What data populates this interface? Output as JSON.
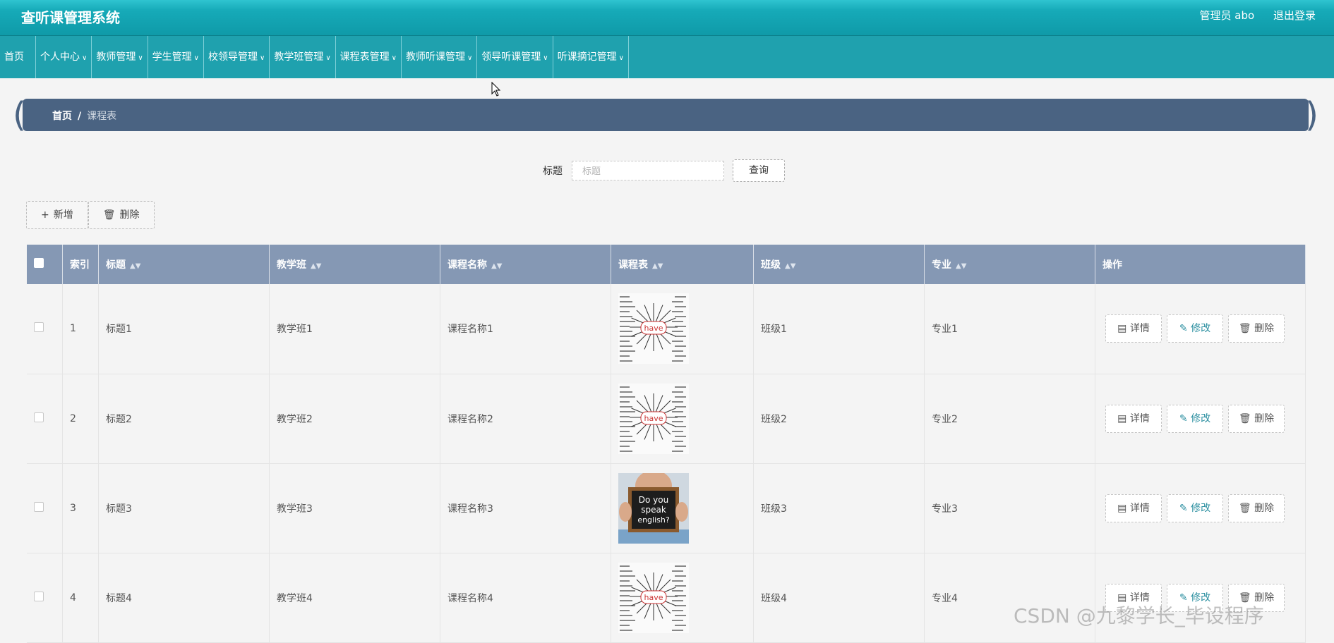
{
  "app": {
    "title": "查听课管理系统"
  },
  "user": {
    "admin_label": "管理员 abo",
    "logout": "退出登录"
  },
  "nav": [
    {
      "label": "首页",
      "dropdown": false
    },
    {
      "label": "个人中心",
      "dropdown": true
    },
    {
      "label": "教师管理",
      "dropdown": true
    },
    {
      "label": "学生管理",
      "dropdown": true
    },
    {
      "label": "校领导管理",
      "dropdown": true
    },
    {
      "label": "教学班管理",
      "dropdown": true
    },
    {
      "label": "课程表管理",
      "dropdown": true
    },
    {
      "label": "教师听课管理",
      "dropdown": true
    },
    {
      "label": "领导听课管理",
      "dropdown": true
    },
    {
      "label": "听课摘记管理",
      "dropdown": true
    }
  ],
  "breadcrumb": {
    "home": "首页",
    "separator": "/",
    "current": "课程表"
  },
  "search": {
    "label": "标题",
    "placeholder": "标题",
    "button": "查询"
  },
  "actions": {
    "add": "新增",
    "delete": "删除"
  },
  "table": {
    "headers": [
      "索引",
      "标题",
      "教学班",
      "课程名称",
      "课程表",
      "班级",
      "专业",
      "操作"
    ],
    "rows": [
      {
        "index": "1",
        "title": "标题1",
        "class": "教学班1",
        "course": "课程名称1",
        "image": "have-wordmap",
        "grade": "班级1",
        "major": "专业1"
      },
      {
        "index": "2",
        "title": "标题2",
        "class": "教学班2",
        "course": "课程名称2",
        "image": "have-wordmap",
        "grade": "班级2",
        "major": "专业2"
      },
      {
        "index": "3",
        "title": "标题3",
        "class": "教学班3",
        "course": "课程名称3",
        "image": "do-you-speak-english",
        "grade": "班级3",
        "major": "专业3"
      },
      {
        "index": "4",
        "title": "标题4",
        "class": "教学班4",
        "course": "课程名称4",
        "image": "have-wordmap",
        "grade": "班级4",
        "major": "专业4"
      }
    ],
    "row_actions": {
      "detail": "详情",
      "edit": "修改",
      "delete": "删除"
    }
  },
  "images": {
    "have_word": "have",
    "sign_text": [
      "Do you",
      "speak",
      "english?"
    ]
  },
  "watermark": "CSDN @九黎学长_毕设程序",
  "colors": {
    "topbar": "#16aab8",
    "navbar": "#1fa1ae",
    "breadcrumb": "#4a6382",
    "table_header": "#8598b4",
    "edit_accent": "#2b8fa0"
  }
}
